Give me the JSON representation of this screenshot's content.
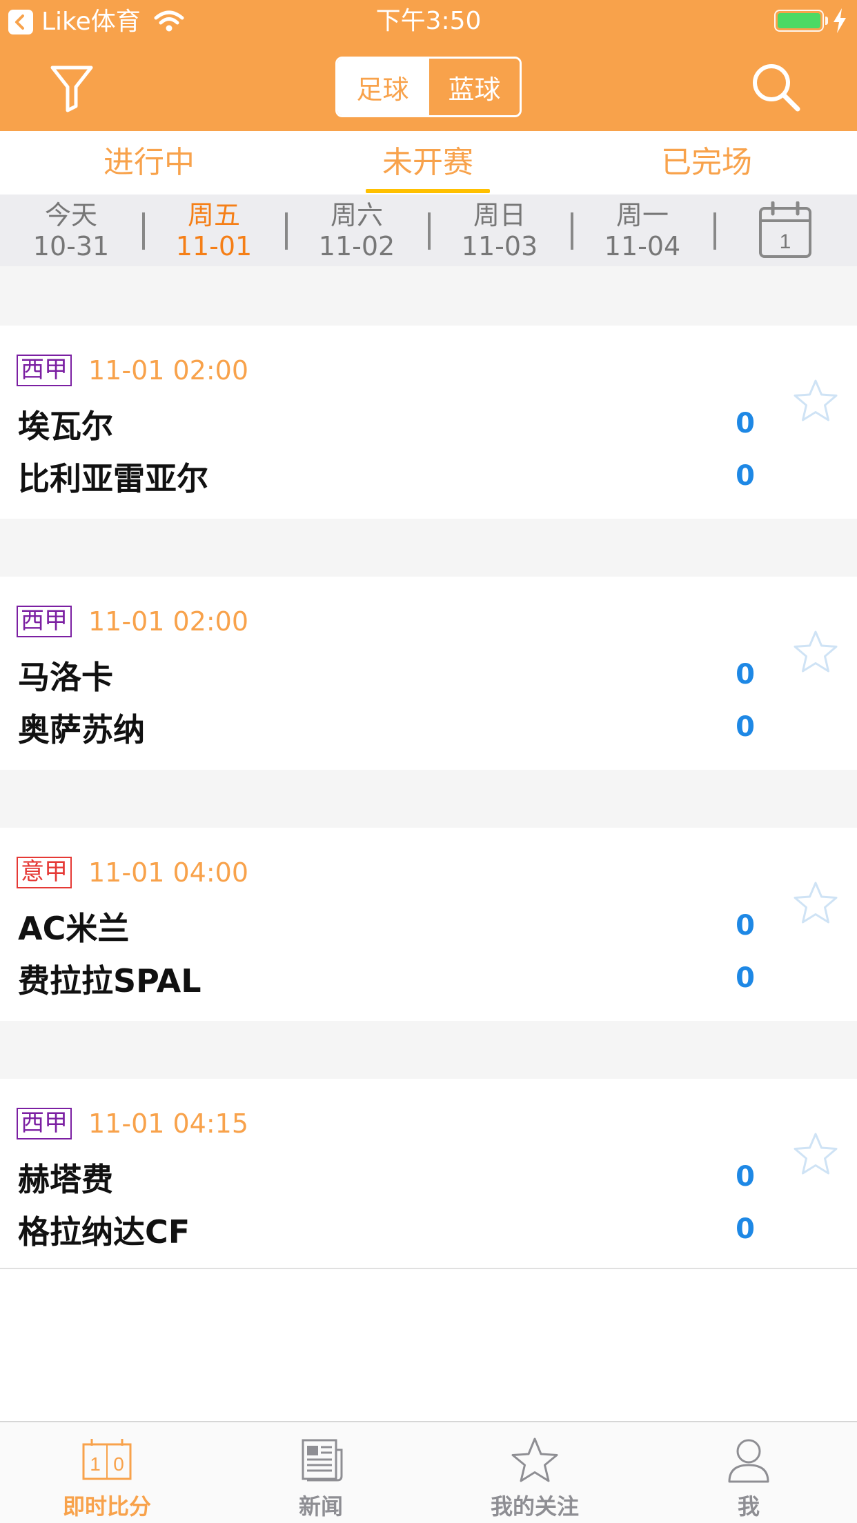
{
  "status_bar": {
    "app": "Like体育",
    "time": "下午3:50"
  },
  "header": {
    "sport_tabs": [
      "足球",
      "蓝球"
    ],
    "filter_icon": "funnel-icon",
    "search_icon": "search-icon"
  },
  "match_tabs": [
    "进行中",
    "未开赛",
    "已完场"
  ],
  "dates": [
    {
      "weekday": "今天",
      "date": "10-31"
    },
    {
      "weekday": "周五",
      "date": "11-01"
    },
    {
      "weekday": "周六",
      "date": "11-02"
    },
    {
      "weekday": "周日",
      "date": "11-03"
    },
    {
      "weekday": "周一",
      "date": "11-04"
    }
  ],
  "calendar_day": "1",
  "matches": [
    {
      "league": "西甲",
      "time": "11-01 02:00",
      "home": "埃瓦尔",
      "away": "比利亚雷亚尔",
      "home_score": "0",
      "away_score": "0"
    },
    {
      "league": "西甲",
      "time": "11-01 02:00",
      "home": "马洛卡",
      "away": "奥萨苏纳",
      "home_score": "0",
      "away_score": "0"
    },
    {
      "league": "意甲",
      "time": "11-01 04:00",
      "home": "AC米兰",
      "away": "费拉拉SPAL",
      "home_score": "0",
      "away_score": "0"
    },
    {
      "league": "西甲",
      "time": "11-01 04:15",
      "home": "赫塔费",
      "away": "格拉纳达CF",
      "home_score": "0",
      "away_score": "0"
    }
  ],
  "tab_bar": [
    {
      "label": "即时比分",
      "icon": "scoreboard-icon"
    },
    {
      "label": "新闻",
      "icon": "newspaper-icon"
    },
    {
      "label": "我的关注",
      "icon": "star-icon"
    },
    {
      "label": "我",
      "icon": "person-icon"
    }
  ],
  "colors": {
    "accent": "#f8a24b",
    "score": "#1e88e5",
    "league_la_liga": "#7b1fa2",
    "league_serie_a": "#e53935"
  }
}
